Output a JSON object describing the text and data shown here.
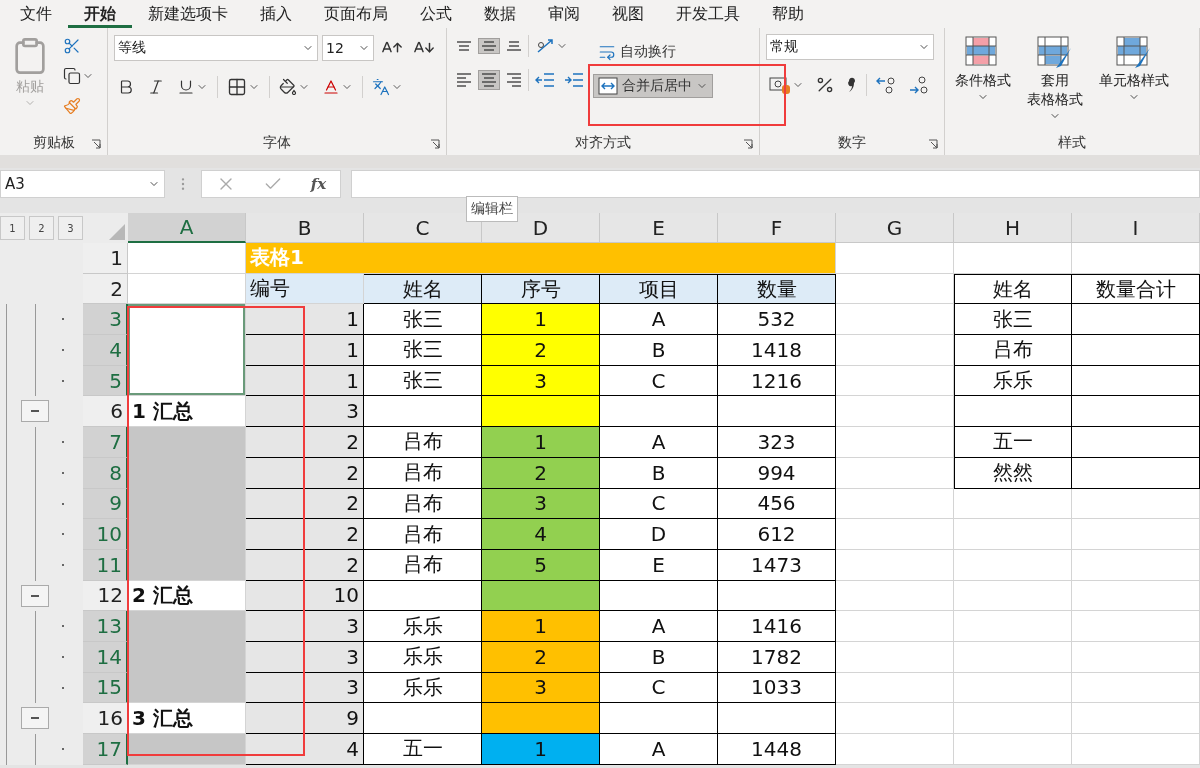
{
  "menu_tabs": [
    {
      "label": "文件",
      "selected": false
    },
    {
      "label": "开始",
      "selected": true
    },
    {
      "label": "新建选项卡",
      "selected": false
    },
    {
      "label": "插入",
      "selected": false
    },
    {
      "label": "页面布局",
      "selected": false
    },
    {
      "label": "公式",
      "selected": false
    },
    {
      "label": "数据",
      "selected": false
    },
    {
      "label": "审阅",
      "selected": false
    },
    {
      "label": "视图",
      "selected": false
    },
    {
      "label": "开发工具",
      "selected": false
    },
    {
      "label": "帮助",
      "selected": false
    }
  ],
  "ribbon": {
    "clipboard": {
      "label": "剪贴板",
      "paste": "粘贴",
      "paste_disabled": true
    },
    "font": {
      "label": "字体",
      "font_name": "等线",
      "font_size": "12"
    },
    "alignment": {
      "label": "对齐方式",
      "buttons": [
        {
          "kind": "top",
          "selected": false
        },
        {
          "kind": "middle",
          "selected": true
        },
        {
          "kind": "bottom",
          "selected": false
        },
        {
          "kind": "left",
          "selected": false
        },
        {
          "kind": "center",
          "selected": true
        },
        {
          "kind": "right",
          "selected": false
        }
      ],
      "wrap_text": "自动换行",
      "merge_center": "合并后居中",
      "merge_pressed": true
    },
    "number": {
      "label": "数字",
      "format": "常规"
    },
    "styles": {
      "label": "样式",
      "buttons": [
        {
          "kind": "conditional",
          "lines": [
            "条件格式"
          ]
        },
        {
          "kind": "table",
          "lines": [
            "套用",
            "表格格式"
          ]
        },
        {
          "kind": "cell",
          "lines": [
            "单元格样式"
          ]
        }
      ]
    }
  },
  "formula_bar": {
    "name_box": "A3",
    "fx": "fx",
    "tooltip": "编辑栏"
  },
  "outline_levels": [
    "1",
    "2",
    "3"
  ],
  "columns": [
    {
      "label": "A",
      "selected": true
    },
    {
      "label": "B",
      "selected": false
    },
    {
      "label": "C",
      "selected": false
    },
    {
      "label": "D",
      "selected": false
    },
    {
      "label": "E",
      "selected": false
    },
    {
      "label": "F",
      "selected": false
    },
    {
      "label": "G",
      "selected": false
    },
    {
      "label": "H",
      "selected": false
    },
    {
      "label": "I",
      "selected": false
    }
  ],
  "rows": [
    {
      "num": "1",
      "selected": false,
      "grouped": false,
      "a": {
        "kind": "blank"
      },
      "kind": "title",
      "title": "表格1",
      "summary_box": false
    },
    {
      "num": "2",
      "selected": false,
      "grouped": false,
      "a": {
        "kind": "blank"
      },
      "kind": "header",
      "b": "编号",
      "c": "姓名",
      "d": {
        "text": "序号"
      },
      "e": "项目",
      "f": "数量",
      "h": "姓名",
      "i": "数量合计",
      "summary_box": true
    },
    {
      "num": "3",
      "selected": true,
      "grouped": true,
      "collapse": false,
      "a": {
        "kind": "active"
      },
      "kind": "data",
      "b": "1",
      "c": "张三",
      "d": {
        "text": "1",
        "color": "#ffff00"
      },
      "e": "A",
      "f": "532",
      "h": "张三",
      "summary_box": true
    },
    {
      "num": "4",
      "selected": true,
      "grouped": true,
      "collapse": false,
      "a": {
        "kind": "active"
      },
      "kind": "data",
      "b": "1",
      "c": "张三",
      "d": {
        "text": "2",
        "color": "#ffff00"
      },
      "e": "B",
      "f": "1418",
      "h": "吕布",
      "summary_box": true
    },
    {
      "num": "5",
      "selected": true,
      "grouped": true,
      "collapse": false,
      "a": {
        "kind": "active"
      },
      "kind": "data",
      "b": "1",
      "c": "张三",
      "d": {
        "text": "3",
        "color": "#ffff00"
      },
      "e": "C",
      "f": "1216",
      "h": "乐乐",
      "summary_box": true
    },
    {
      "num": "6",
      "selected": false,
      "grouped": true,
      "collapse": true,
      "a": {
        "kind": "subtotal",
        "text": "1 汇总"
      },
      "kind": "data",
      "b": "3",
      "d": {
        "color": "#ffff00"
      },
      "summary_box": true
    },
    {
      "num": "7",
      "selected": true,
      "grouped": true,
      "collapse": false,
      "a": {
        "kind": "selected"
      },
      "kind": "data",
      "b": "2",
      "c": "吕布",
      "d": {
        "text": "1",
        "color": "#92d050"
      },
      "e": "A",
      "f": "323",
      "h": "五一",
      "summary_box": true
    },
    {
      "num": "8",
      "selected": true,
      "grouped": true,
      "collapse": false,
      "a": {
        "kind": "selected"
      },
      "kind": "data",
      "b": "2",
      "c": "吕布",
      "d": {
        "text": "2",
        "color": "#92d050"
      },
      "e": "B",
      "f": "994",
      "h": "然然",
      "summary_box": true
    },
    {
      "num": "9",
      "selected": true,
      "grouped": true,
      "collapse": false,
      "a": {
        "kind": "selected"
      },
      "kind": "data",
      "b": "2",
      "c": "吕布",
      "d": {
        "text": "3",
        "color": "#92d050"
      },
      "e": "C",
      "f": "456",
      "summary_box": false
    },
    {
      "num": "10",
      "selected": true,
      "grouped": true,
      "collapse": false,
      "a": {
        "kind": "selected"
      },
      "kind": "data",
      "b": "2",
      "c": "吕布",
      "d": {
        "text": "4",
        "color": "#92d050"
      },
      "e": "D",
      "f": "612",
      "summary_box": false
    },
    {
      "num": "11",
      "selected": true,
      "grouped": true,
      "collapse": false,
      "a": {
        "kind": "selected"
      },
      "kind": "data",
      "b": "2",
      "c": "吕布",
      "d": {
        "text": "5",
        "color": "#92d050"
      },
      "e": "E",
      "f": "1473",
      "summary_box": false
    },
    {
      "num": "12",
      "selected": false,
      "grouped": true,
      "collapse": true,
      "a": {
        "kind": "subtotal",
        "text": "2 汇总"
      },
      "kind": "data",
      "b": "10",
      "d": {
        "color": "#92d050"
      },
      "summary_box": false
    },
    {
      "num": "13",
      "selected": true,
      "grouped": true,
      "collapse": false,
      "a": {
        "kind": "selected"
      },
      "kind": "data",
      "b": "3",
      "c": "乐乐",
      "d": {
        "text": "1",
        "color": "#ffc000"
      },
      "e": "A",
      "f": "1416",
      "summary_box": false
    },
    {
      "num": "14",
      "selected": true,
      "grouped": true,
      "collapse": false,
      "a": {
        "kind": "selected"
      },
      "kind": "data",
      "b": "3",
      "c": "乐乐",
      "d": {
        "text": "2",
        "color": "#ffc000"
      },
      "e": "B",
      "f": "1782",
      "summary_box": false
    },
    {
      "num": "15",
      "selected": true,
      "grouped": true,
      "collapse": false,
      "a": {
        "kind": "selected"
      },
      "kind": "data",
      "b": "3",
      "c": "乐乐",
      "d": {
        "text": "3",
        "color": "#ffc000"
      },
      "e": "C",
      "f": "1033",
      "summary_box": false
    },
    {
      "num": "16",
      "selected": false,
      "grouped": true,
      "collapse": true,
      "a": {
        "kind": "subtotal",
        "text": "3 汇总"
      },
      "kind": "data",
      "b": "9",
      "d": {
        "color": "#ffc000"
      },
      "summary_box": false
    },
    {
      "num": "17",
      "selected": true,
      "grouped": true,
      "collapse": false,
      "a": {
        "kind": "selected"
      },
      "kind": "data",
      "b": "4",
      "c": "五一",
      "d": {
        "text": "1",
        "color": "#00b0f0"
      },
      "e": "A",
      "f": "1448",
      "summary_box": false
    }
  ],
  "highlight_frames": {
    "merge_button": true,
    "column_a": true
  }
}
